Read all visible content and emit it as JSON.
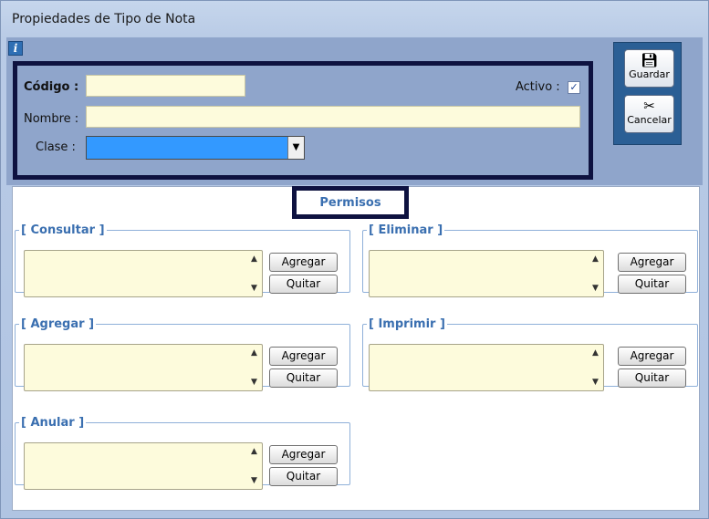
{
  "window": {
    "title": "Propiedades de Tipo de Nota"
  },
  "form": {
    "codigo_label": "Código :",
    "codigo_value": "",
    "activo_label": "Activo :",
    "activo_checked": true,
    "nombre_label": "Nombre :",
    "nombre_value": "",
    "clase_label": "Clase :",
    "clase_value": ""
  },
  "actions": {
    "guardar_label": "Guardar",
    "cancelar_label": "Cancelar"
  },
  "tab": {
    "label": "Permisos"
  },
  "groups": [
    {
      "title": "[ Consultar ]",
      "add_label": "Agregar",
      "remove_label": "Quitar"
    },
    {
      "title": "[ Eliminar ]",
      "add_label": "Agregar",
      "remove_label": "Quitar"
    },
    {
      "title": "[ Agregar ]",
      "add_label": "Agregar",
      "remove_label": "Quitar"
    },
    {
      "title": "[ Imprimir ]",
      "add_label": "Agregar",
      "remove_label": "Quitar"
    },
    {
      "title": "[ Anular ]",
      "add_label": "Agregar",
      "remove_label": "Quitar"
    }
  ],
  "icons": {
    "info": "info-icon",
    "save": "floppy-disk-icon",
    "cancel": "scissors-icon",
    "scroll_up": "scroll-up-arrow-icon",
    "scroll_down": "scroll-down-arrow-icon",
    "dropdown": "chevron-down-icon"
  },
  "colors": {
    "highlight_border": "#0e1240",
    "group_title": "#3a6fb0",
    "input_background": "#fdfbdc",
    "select_highlight": "#3399ff",
    "side_panel": "#2b5f95"
  }
}
